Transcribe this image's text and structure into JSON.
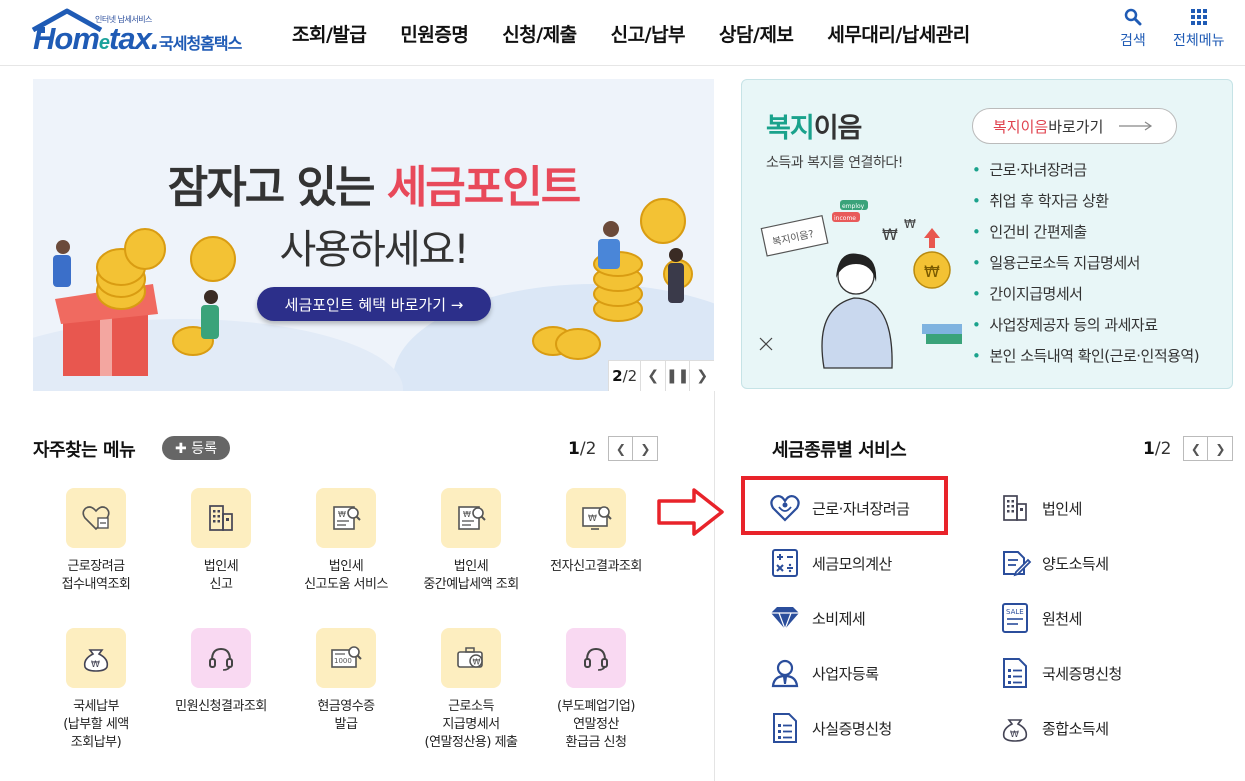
{
  "header": {
    "logo_small": "인터넷 납세서비스",
    "logo_main_1": "Hom",
    "logo_main_e": "e",
    "logo_main_2": "tax.",
    "logo_kr": "국세청홈택스",
    "nav": [
      "조회/발급",
      "민원증명",
      "신청/제출",
      "신고/납부",
      "상담/제보",
      "세무대리/납세관리"
    ],
    "search_label": "검색",
    "allmenu_label": "전체메뉴"
  },
  "banner": {
    "line1_a": "잠자고 있는 ",
    "line1_b": "세금포인트",
    "line2": "사용하세요!",
    "button": "세금포인트 혜택 바로가기 →",
    "page_current": "2",
    "page_total": "/2"
  },
  "welfare": {
    "title_a": "복지",
    "title_b": "이음",
    "subtitle": "소득과 복지를 연결하다!",
    "link_a": "복지이음",
    "link_b": " 바로가기",
    "items": [
      "근로·자녀장려금",
      "취업 후 학자금 상환",
      "인건비 간편제출",
      "일용근로소득 지급명세서",
      "간이지급명세서",
      "사업장제공자 등의 과세자료",
      "본인 소득내역 확인(근로·인적용역)"
    ],
    "illust_sign": "복지이음?",
    "illust_tag1": "employ",
    "illust_tag2": "income"
  },
  "favorites": {
    "title": "자주찾는 메뉴",
    "register": "✚ 등록",
    "page_current": "1",
    "page_total": "/2",
    "items": [
      {
        "label1": "근로장려금",
        "label2": "접수내역조회",
        "label3": "",
        "icon": "heart-tag-icon",
        "pink": false
      },
      {
        "label1": "법인세",
        "label2": "신고",
        "label3": "",
        "icon": "building-icon",
        "pink": false
      },
      {
        "label1": "법인세",
        "label2": "신고도움 서비스",
        "label3": "",
        "icon": "document-search-icon",
        "pink": false
      },
      {
        "label1": "법인세",
        "label2": "중간예납세액 조회",
        "label3": "",
        "icon": "document-search-icon",
        "pink": false
      },
      {
        "label1": "전자신고결과조회",
        "label2": "",
        "label3": "",
        "icon": "monitor-search-icon",
        "pink": false
      },
      {
        "label1": "국세납부",
        "label2": "(납부할 세액",
        "label3": "조회납부)",
        "icon": "money-bag-icon",
        "pink": false
      },
      {
        "label1": "민원신청결과조회",
        "label2": "",
        "label3": "",
        "icon": "headset-icon",
        "pink": true
      },
      {
        "label1": "현금영수증",
        "label2": "발급",
        "label3": "",
        "icon": "receipt-search-icon",
        "pink": false
      },
      {
        "label1": "근로소득",
        "label2": "지급명세서",
        "label3": "(연말정산용) 제출",
        "icon": "briefcase-icon",
        "pink": false
      },
      {
        "label1": "(부도폐업기업)",
        "label2": "연말정산",
        "label3": "환급금 신청",
        "icon": "headset-icon",
        "pink": true
      }
    ],
    "receipt_text": "1000"
  },
  "services": {
    "title": "세금종류별 서비스",
    "page_current": "1",
    "page_total": "/2",
    "items": [
      {
        "label": "근로·자녀장려금",
        "icon": "heart-hands-icon"
      },
      {
        "label": "법인세",
        "icon": "building-icon"
      },
      {
        "label": "세금모의계산",
        "icon": "calculator-icon"
      },
      {
        "label": "양도소득세",
        "icon": "document-pen-icon"
      },
      {
        "label": "소비제세",
        "icon": "diamond-icon"
      },
      {
        "label": "원천세",
        "icon": "sale-tag-icon"
      },
      {
        "label": "사업자등록",
        "icon": "person-icon"
      },
      {
        "label": "국세증명신청",
        "icon": "document-icon"
      },
      {
        "label": "사실증명신청",
        "icon": "document-icon"
      },
      {
        "label": "종합소득세",
        "icon": "money-bag-icon"
      }
    ],
    "sale_text": "SALE"
  },
  "colors": {
    "brand_blue": "#1f5bb5",
    "accent_red": "#e8495a",
    "welfare_green": "#1aa28c",
    "highlight_red": "#e8232a"
  }
}
